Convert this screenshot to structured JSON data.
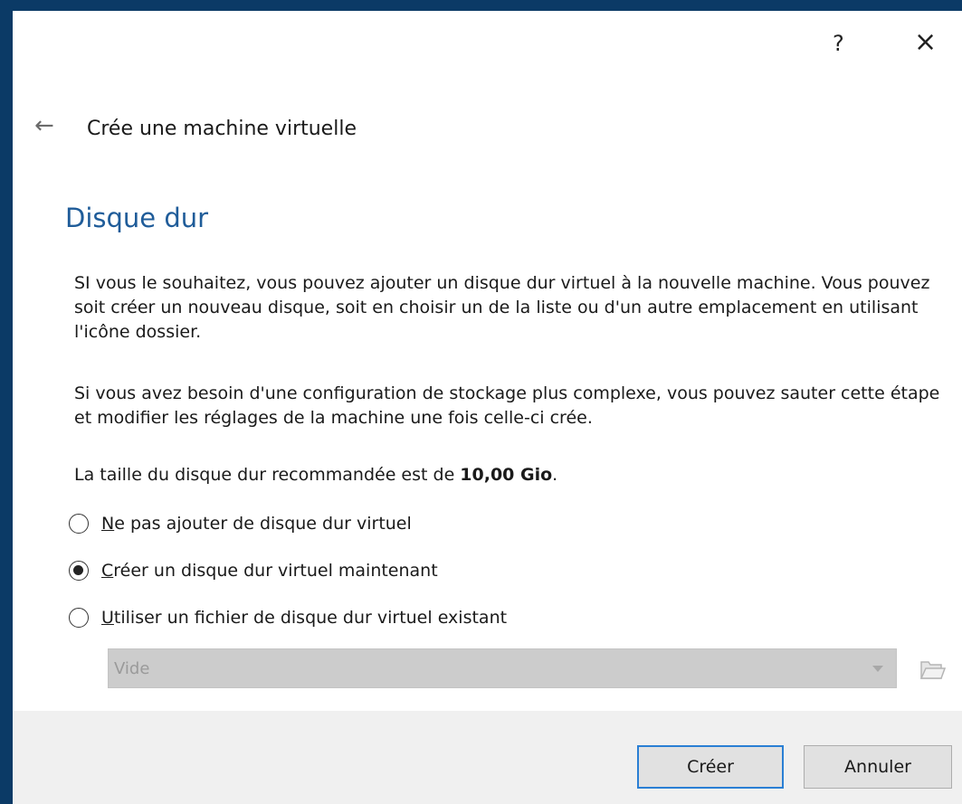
{
  "titlebar": {
    "help_label": "?",
    "close_label": "×"
  },
  "wizard": {
    "back_label": "←",
    "title": "Crée une machine virtuelle",
    "heading": "Disque dur"
  },
  "content": {
    "paragraph1": "SI vous le souhaitez, vous pouvez ajouter un disque dur virtuel à la nouvelle machine. Vous pouvez soit créer un nouveau disque, soit en choisir un de la liste ou d'un autre emplacement en utilisant l'icône dossier.",
    "paragraph2": "Si vous avez besoin d'une configuration de stockage plus complexe, vous pouvez sauter cette étape et modifier les réglages de la machine une fois celle-ci crée.",
    "recommended_prefix": "La taille du disque dur recommandée est de ",
    "recommended_size": "10,00 Gio",
    "recommended_suffix": "."
  },
  "options": [
    {
      "mnemonic": "N",
      "rest": "e pas ajouter de disque dur virtuel",
      "checked": false
    },
    {
      "mnemonic": "C",
      "rest": "réer un disque dur virtuel maintenant",
      "checked": true
    },
    {
      "mnemonic": "U",
      "rest": "tiliser un fichier de disque dur virtuel existant",
      "checked": false
    }
  ],
  "file_select": {
    "value": "Vide",
    "folder_icon": "folder-open-icon"
  },
  "footer": {
    "create_label": "Créer",
    "cancel_label": "Annuler"
  },
  "colors": {
    "heading": "#1f5c99",
    "accent_border": "#2a7fd4",
    "desktop": "#0b3a66",
    "footer_bg": "#f0f0f0"
  }
}
